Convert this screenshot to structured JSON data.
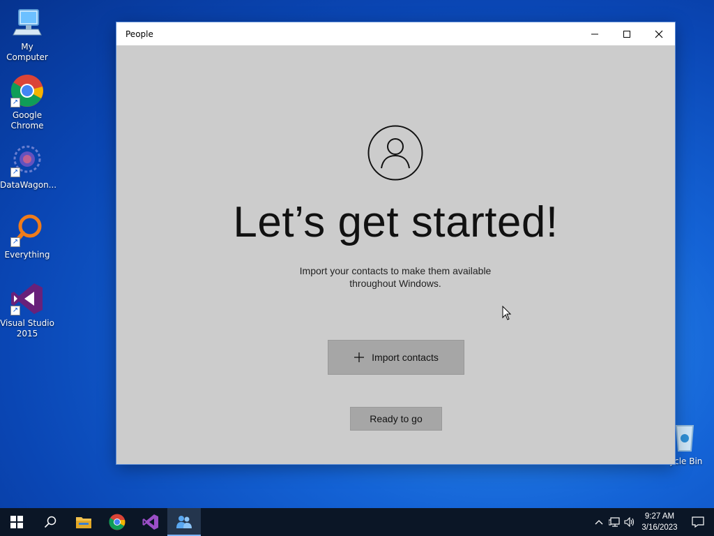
{
  "desktop": {
    "icons": [
      {
        "label": "My Computer",
        "icon": "computer-icon"
      },
      {
        "label": "Google Chrome",
        "icon": "chrome-icon"
      },
      {
        "label": "DataWagon...",
        "icon": "datawagon-icon"
      },
      {
        "label": "Everything",
        "icon": "everything-icon"
      },
      {
        "label": "Visual Studio 2015",
        "icon": "visual-studio-icon"
      },
      {
        "label": "ycle Bin",
        "icon": "recycle-bin-icon"
      }
    ]
  },
  "window": {
    "title": "People",
    "controls": [
      "minimize",
      "maximize",
      "close"
    ]
  },
  "people": {
    "headline": "Let’s get started!",
    "subtext": "Import your contacts to make them available throughout Windows.",
    "import_button": "Import contacts",
    "ready_button": "Ready to go"
  },
  "taskbar": {
    "apps": [
      "start-icon",
      "search-icon",
      "file-explorer-icon",
      "chrome-icon",
      "visual-studio-icon",
      "people-icon"
    ],
    "active_app": "people-icon",
    "clock_time": "9:27 AM",
    "clock_date": "3/16/2023"
  },
  "colors": {
    "window_bg": "#cccccc",
    "button_bg": "#a6a6a6",
    "taskbar_bg": "#0b1626"
  }
}
